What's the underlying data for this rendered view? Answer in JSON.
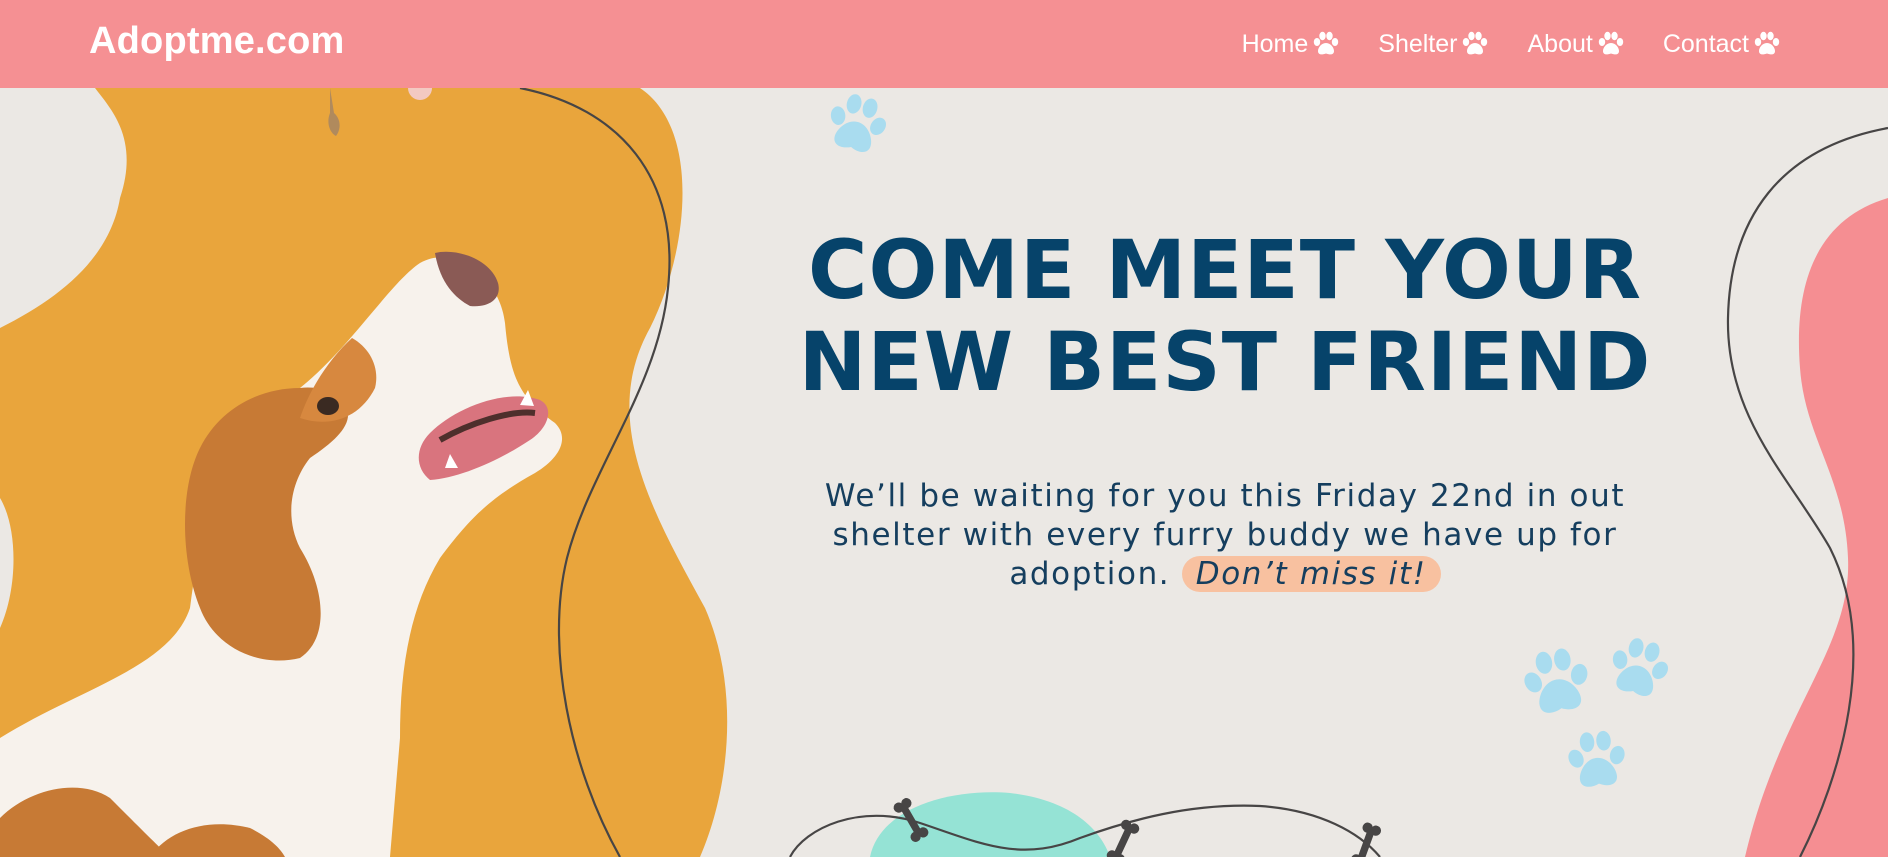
{
  "header": {
    "brand": "Adoptme.com",
    "nav": [
      {
        "label": "Home",
        "icon": "paw-icon"
      },
      {
        "label": "Shelter",
        "icon": "paw-icon"
      },
      {
        "label": "About",
        "icon": "paw-icon"
      },
      {
        "label": "Contact",
        "icon": "paw-icon"
      }
    ]
  },
  "hero": {
    "headline_line1": "COME MEET YOUR",
    "headline_line2": "NEW BEST FRIEND",
    "tagline_text": "We’ll be waiting for you this Friday 22nd in out shelter with every furry buddy we have up for adoption.",
    "tagline_highlight": "Don’t miss it!",
    "image": "beagle-dog-photo"
  },
  "colors": {
    "navbar": "#f59093",
    "background": "#ebe8e4",
    "headline": "#06436a",
    "body_text": "#153e5e",
    "blob_orange": "#e9a53c",
    "blob_pink": "#f58e92",
    "blob_teal": "#95e3d5",
    "paw_blue": "#a9dcef",
    "highlight": "#f8c1a0",
    "line": "#474545"
  }
}
